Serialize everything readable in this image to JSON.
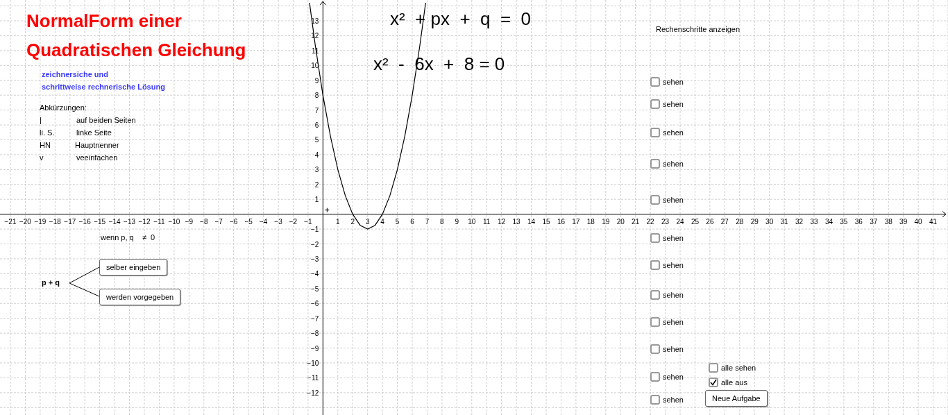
{
  "title_lines": [
    "NormalForm einer",
    "Quadratischen Gleichung"
  ],
  "subtitle_lines": [
    "zeichnersiche und",
    "schrittweise rechnerische Lösung"
  ],
  "abbreviations": {
    "heading": "Abkürzungen:",
    "rows": [
      {
        "abbr": "|",
        "meaning": "auf beiden Seiten"
      },
      {
        "abbr": "li. S.",
        "meaning": "linke Seite"
      },
      {
        "abbr": "HN",
        "meaning": "Hauptnenner"
      },
      {
        "abbr": "v",
        "meaning": "veeinfachen"
      }
    ]
  },
  "general_equation": "x²  + px  +  q  =  0",
  "example_equation": "x²  -  6x  +  8 = 0",
  "condition": "wenn p, q    ≠  0",
  "pq_label": "p + q",
  "pq_buttons": [
    "selber eingeben",
    "werden vorgegeben"
  ],
  "steps_heading": "Rechenschritte anzeigen",
  "step_checkboxes": [
    {
      "label": "sehen",
      "checked": false
    },
    {
      "label": "sehen",
      "checked": false
    },
    {
      "label": "sehen",
      "checked": false
    },
    {
      "label": "sehen",
      "checked": false
    },
    {
      "label": "sehen",
      "checked": false
    },
    {
      "label": "sehen",
      "checked": false
    },
    {
      "label": "sehen",
      "checked": false
    },
    {
      "label": "sehen",
      "checked": false
    },
    {
      "label": "sehen",
      "checked": false
    },
    {
      "label": "sehen",
      "checked": false
    },
    {
      "label": "sehen",
      "checked": false
    },
    {
      "label": "sehen",
      "checked": false
    }
  ],
  "all_checkboxes": [
    {
      "label": "alle sehen",
      "checked": false
    },
    {
      "label": "alle aus",
      "checked": true
    }
  ],
  "new_task_button": "Neue Aufgabe",
  "graph": {
    "chart_data": {
      "type": "line",
      "x": [
        -0.9,
        -0.5,
        0,
        0.5,
        1,
        1.5,
        2,
        2.5,
        3,
        3.5,
        4,
        4.5,
        5,
        5.5,
        6,
        6.5,
        6.9
      ],
      "grid": true,
      "series": [
        {
          "color": "#000000",
          "values": [
            14.21,
            11.25,
            8,
            5.25,
            3,
            1.25,
            0,
            -0.75,
            -1,
            -0.75,
            0,
            1.25,
            3,
            5.25,
            8,
            11.25,
            14.21
          ]
        }
      ],
      "xlim": [
        -21.7,
        42
      ],
      "ylim": [
        -13.5,
        14.4
      ],
      "xticks": [
        -21,
        -20,
        -19,
        -18,
        -17,
        -16,
        -15,
        -14,
        -13,
        -12,
        -11,
        -10,
        -9,
        -8,
        -7,
        -6,
        -5,
        -4,
        -3,
        -2,
        -1,
        1,
        2,
        3,
        4,
        5,
        6,
        7,
        8,
        9,
        10,
        11,
        12,
        13,
        14,
        15,
        16,
        17,
        18,
        19,
        20,
        21,
        22,
        23,
        24,
        25,
        26,
        27,
        28,
        29,
        30,
        31,
        32,
        33,
        34,
        35,
        36,
        37,
        38,
        39,
        40,
        41
      ],
      "yticks": [
        -12,
        -11,
        -10,
        -9,
        -8,
        -7,
        -6,
        -5,
        -4,
        -3,
        -2,
        -1,
        1,
        2,
        3,
        4,
        5,
        6,
        7,
        8,
        9,
        10,
        11,
        12,
        13
      ]
    }
  }
}
